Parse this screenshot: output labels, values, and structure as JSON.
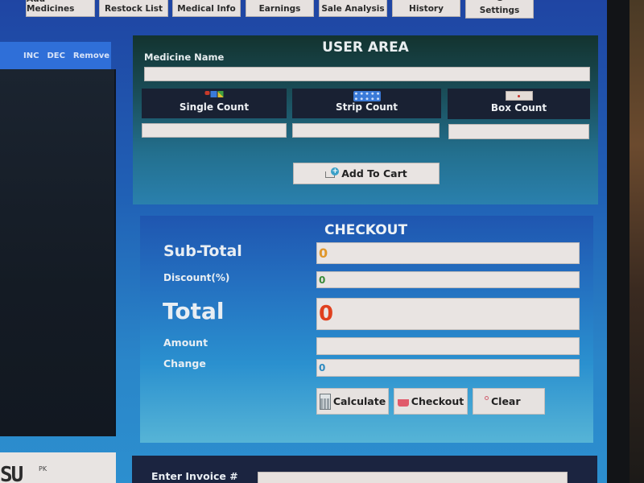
{
  "toolbar": {
    "buttons": [
      {
        "label": "Add Medicines",
        "icon": "pill-icon"
      },
      {
        "label": "Restock List",
        "icon": "clipboard-icon"
      },
      {
        "label": "Medical Info",
        "icon": "info-icon"
      },
      {
        "label": "Earnings",
        "icon": "money-icon"
      },
      {
        "label": "Sale Analysis",
        "icon": "bar-chart-icon"
      },
      {
        "label": "History",
        "icon": "history-icon"
      },
      {
        "label": "Settings",
        "icon": "gear-icon"
      }
    ]
  },
  "cart": {
    "actions": {
      "inc": "INC",
      "dec": "DEC",
      "remove": "Remove"
    }
  },
  "logo": {
    "mark": "SU",
    "suffix": "PK"
  },
  "user_area": {
    "title": "USER AREA",
    "medicine_name_label": "Medicine Name",
    "medicine_name_value": "",
    "counts": [
      {
        "label": "Single Count",
        "icon": "single-pills-icon",
        "value": ""
      },
      {
        "label": "Strip Count",
        "icon": "pill-strip-icon",
        "value": ""
      },
      {
        "label": "Box Count",
        "icon": "medicine-box-icon",
        "value": ""
      }
    ],
    "add_to_cart_label": "Add To Cart"
  },
  "checkout": {
    "title": "CHECKOUT",
    "subtotal_label": "Sub-Total",
    "subtotal_value": "0",
    "discount_label": "Discount(%)",
    "discount_value": "0",
    "total_label": "Total",
    "total_value": "0",
    "amount_label": "Amount",
    "amount_value": "",
    "change_label": "Change",
    "change_value": "0",
    "buttons": {
      "calculate": "Calculate",
      "checkout": "Checkout",
      "clear": "Clear"
    }
  },
  "invoice": {
    "label": "Enter Invoice #",
    "value": ""
  },
  "colors": {
    "subtotal_value": "#e0962a",
    "discount_value": "#3a8a3a",
    "total_value": "#e0401e",
    "change_value": "#2f8ac0"
  }
}
